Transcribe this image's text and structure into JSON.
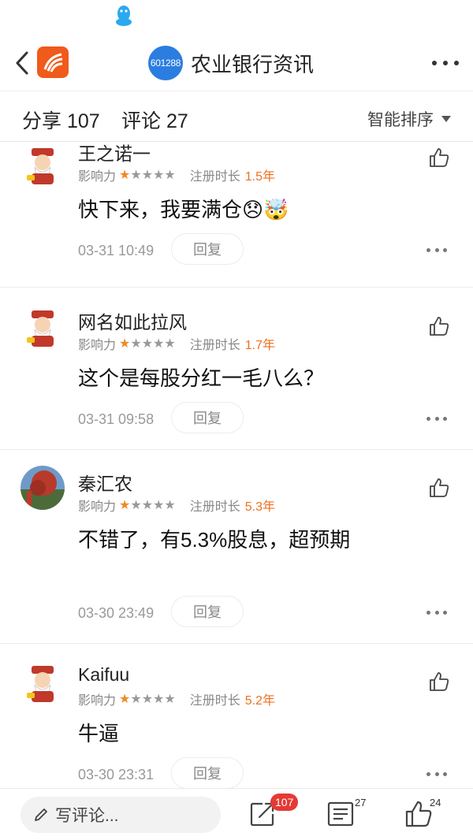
{
  "header": {
    "stock_code": "601288",
    "title": "农业银行资讯"
  },
  "tabs": {
    "share_label": "分享 107",
    "comment_label": "评论 27",
    "sort_label": "智能排序"
  },
  "labels": {
    "influence": "影响力",
    "registered": "注册时长",
    "reply": "回复"
  },
  "comments": [
    {
      "user": "王之诺一",
      "stars": 1,
      "reg": "1.5年",
      "text": "快下来，我要满仓😞🤯",
      "time": "03-31 10:49",
      "avatar": "caishen-avatar"
    },
    {
      "user": "网名如此拉风",
      "stars": 1,
      "reg": "1.7年",
      "text": "这个是每股分红一毛八么？",
      "time": "03-31 09:58",
      "avatar": "caishen-avatar"
    },
    {
      "user": "秦汇农",
      "stars": 1,
      "reg": "5.3年",
      "text": "不错了，有5.3%股息，超预期",
      "time": "03-30 23:49",
      "avatar": "photo-avatar"
    },
    {
      "user": "Kaifuu",
      "stars": 1,
      "reg": "5.2年",
      "text": "牛逼",
      "time": "03-30 23:31",
      "avatar": "caishen-avatar"
    }
  ],
  "bottom": {
    "input_placeholder": "写评论...",
    "share_count": "107",
    "comment_count": "27",
    "like_count": "24"
  },
  "colors": {
    "accent_orange": "#f07020",
    "badge_blue": "#2b7de0",
    "badge_red": "#e53935",
    "logo_orange": "#f05a1a"
  }
}
